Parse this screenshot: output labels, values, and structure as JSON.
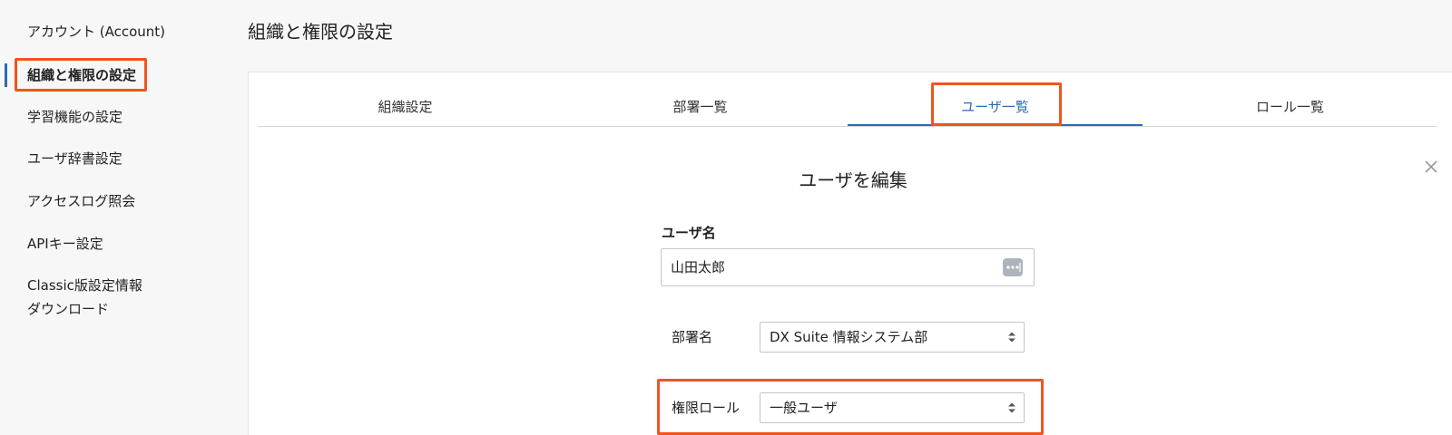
{
  "sidebar": {
    "items": [
      {
        "label": "アカウント (Account)"
      },
      {
        "label": "組織と権限の設定"
      },
      {
        "label": "学習機能の設定"
      },
      {
        "label": "ユーザ辞書設定"
      },
      {
        "label": "アクセスログ照会"
      },
      {
        "label": "APIキー設定"
      },
      {
        "label_line1": "Classic版設定情報",
        "label_line2": "ダウンロード"
      }
    ],
    "active_item": "組織と権限の設定"
  },
  "header": {
    "title": "組織と権限の設定"
  },
  "tabs": [
    {
      "label": "組織設定"
    },
    {
      "label": "部署一覧"
    },
    {
      "label": "ユーザ一覧"
    },
    {
      "label": "ロール一覧"
    }
  ],
  "active_tab": "ユーザ一覧",
  "modal": {
    "title": "ユーザを編集",
    "username": {
      "label": "ユーザ名",
      "value": "山田太郎"
    },
    "department": {
      "label": "部署名",
      "selected": "DX Suite 情報システム部"
    },
    "role": {
      "label": "権限ロール",
      "selected": "一般ユーザ"
    }
  },
  "colors": {
    "accent": "#2b6cb0",
    "highlight": "#f0541e"
  }
}
